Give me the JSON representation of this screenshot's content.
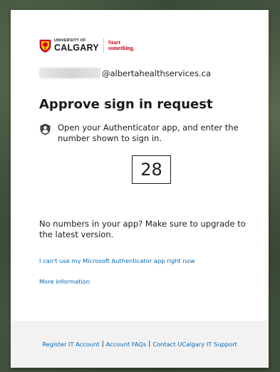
{
  "brand": {
    "university_small": "UNIVERSITY OF",
    "university_name": "CALGARY",
    "tagline_line1": "Start",
    "tagline_line2": "something.",
    "primary_color": "#d6001c",
    "gold_color": "#ffcd00"
  },
  "identity": {
    "email_domain": "@albertahealthservices.ca"
  },
  "main": {
    "title": "Approve sign in request",
    "instruction": "Open your Authenticator app, and enter the number shown to sign in.",
    "number": "28",
    "upgrade_note": "No numbers in your app? Make sure to upgrade to the latest version."
  },
  "links": {
    "cant_use": "I can't use my Microsoft Authenticator app right now",
    "more_info": "More information",
    "color": "#0067b8"
  },
  "footer": {
    "items": [
      "Register IT Account",
      "Account FAQs",
      "Contact UCalgary IT Support"
    ],
    "separator": "|"
  },
  "icons": {
    "instruction_icon": "authenticator-lock-icon",
    "logo_icon": "university-shield-icon"
  }
}
